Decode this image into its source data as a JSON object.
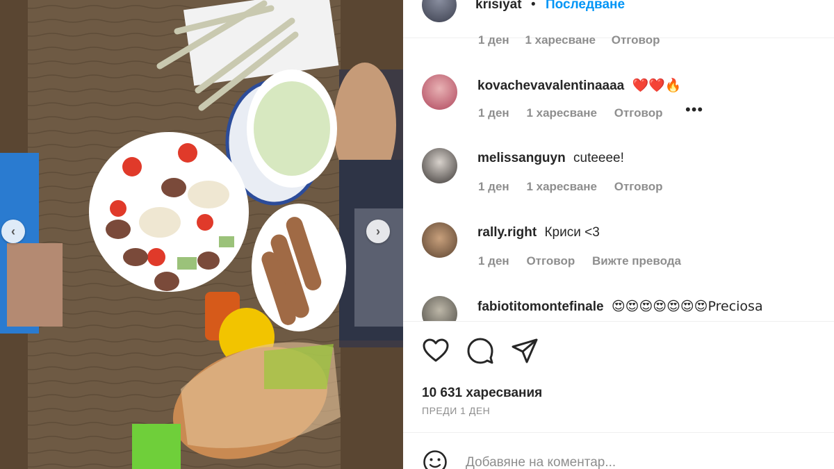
{
  "post_header": {
    "username": "krisiyat",
    "separator": "•",
    "follow_label": "Последване"
  },
  "top_meta": {
    "time": "1 ден",
    "likes": "1 харесване",
    "reply": "Отговор"
  },
  "comments": [
    {
      "username": "kovachevavalentinaaaa",
      "text": "❤️❤️🔥",
      "time": "1 ден",
      "likes": "1 харесване",
      "reply": "Отговор",
      "more": "•••"
    },
    {
      "username": "melissanguyn",
      "text": "cuteeee!",
      "time": "1 ден",
      "likes": "1 харесване",
      "reply": "Отговор"
    },
    {
      "username": "rally.right",
      "text": "Криси <3",
      "time": "1 ден",
      "reply": "Отговор",
      "translate": "Вижте превода"
    },
    {
      "username": "fabiotitomontefinale",
      "text": "😍😍😍😍😍😍😍Preciosa"
    }
  ],
  "actions": {
    "like_icon": "heart-icon",
    "comment_icon": "comment-icon",
    "share_icon": "share-icon"
  },
  "likes_count": "10 631 харесвания",
  "post_time": "ПРЕДИ 1 ДЕН",
  "add_comment": {
    "placeholder": "Добавяне на коментар..."
  },
  "photo_nav": {
    "prev": "‹",
    "next": "›"
  }
}
